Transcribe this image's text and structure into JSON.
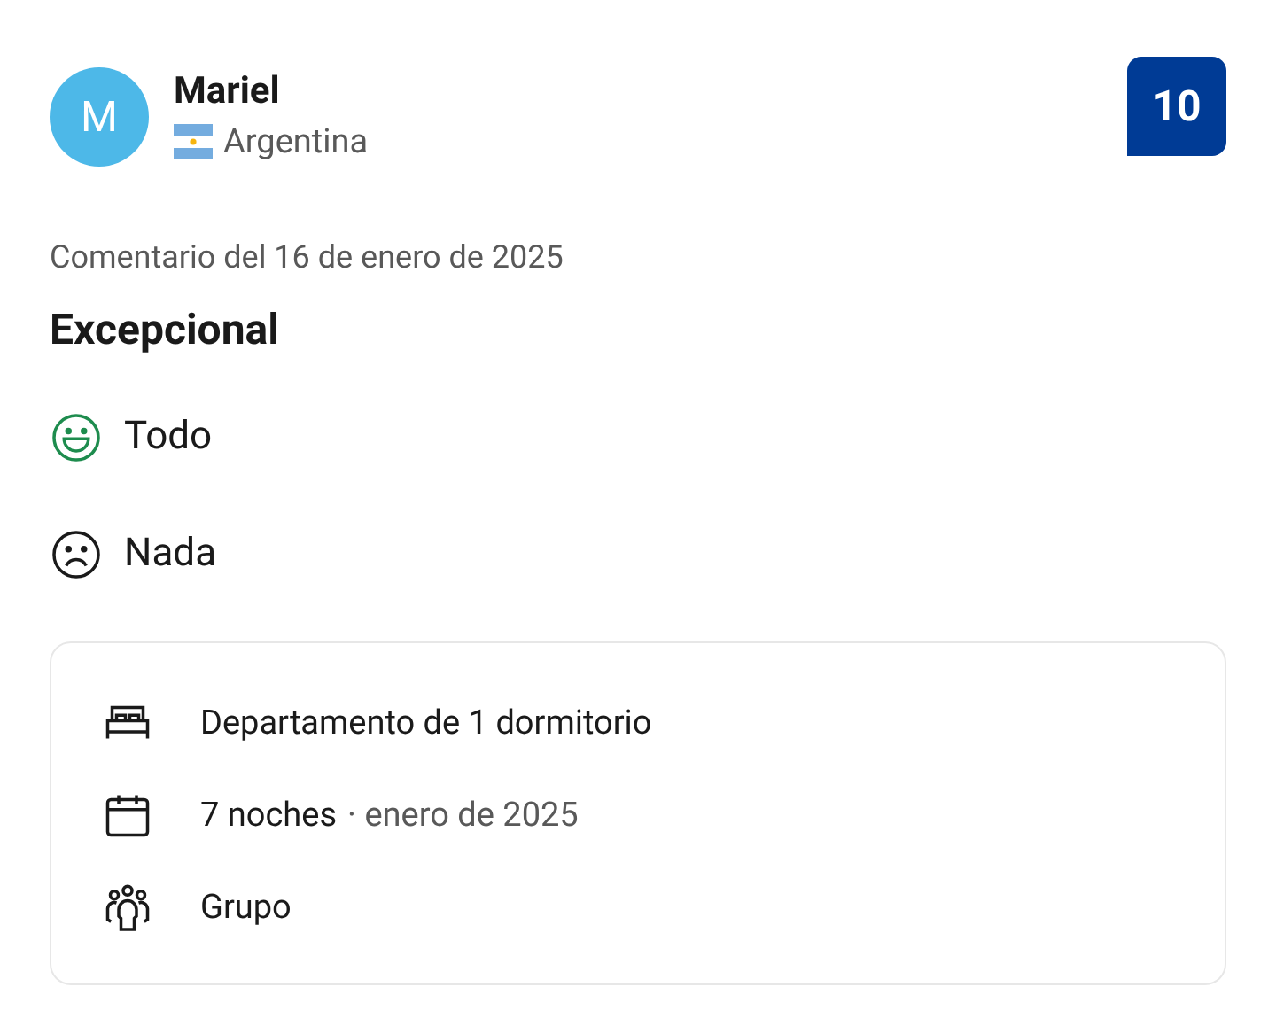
{
  "reviewer": {
    "initial": "M",
    "name": "Mariel",
    "country": "Argentina"
  },
  "score": "10",
  "review_date": "Comentario del 16 de enero de 2025",
  "title": "Excepcional",
  "opinions": [
    {
      "kind": "positive",
      "text": "Todo"
    },
    {
      "kind": "negative",
      "text": "Nada"
    }
  ],
  "stay": [
    {
      "kind": "room",
      "text": "Departamento de 1 dormitorio"
    },
    {
      "kind": "dates",
      "text": "7 noches",
      "detail": "· enero de 2025"
    },
    {
      "kind": "group",
      "text": "Grupo"
    }
  ]
}
